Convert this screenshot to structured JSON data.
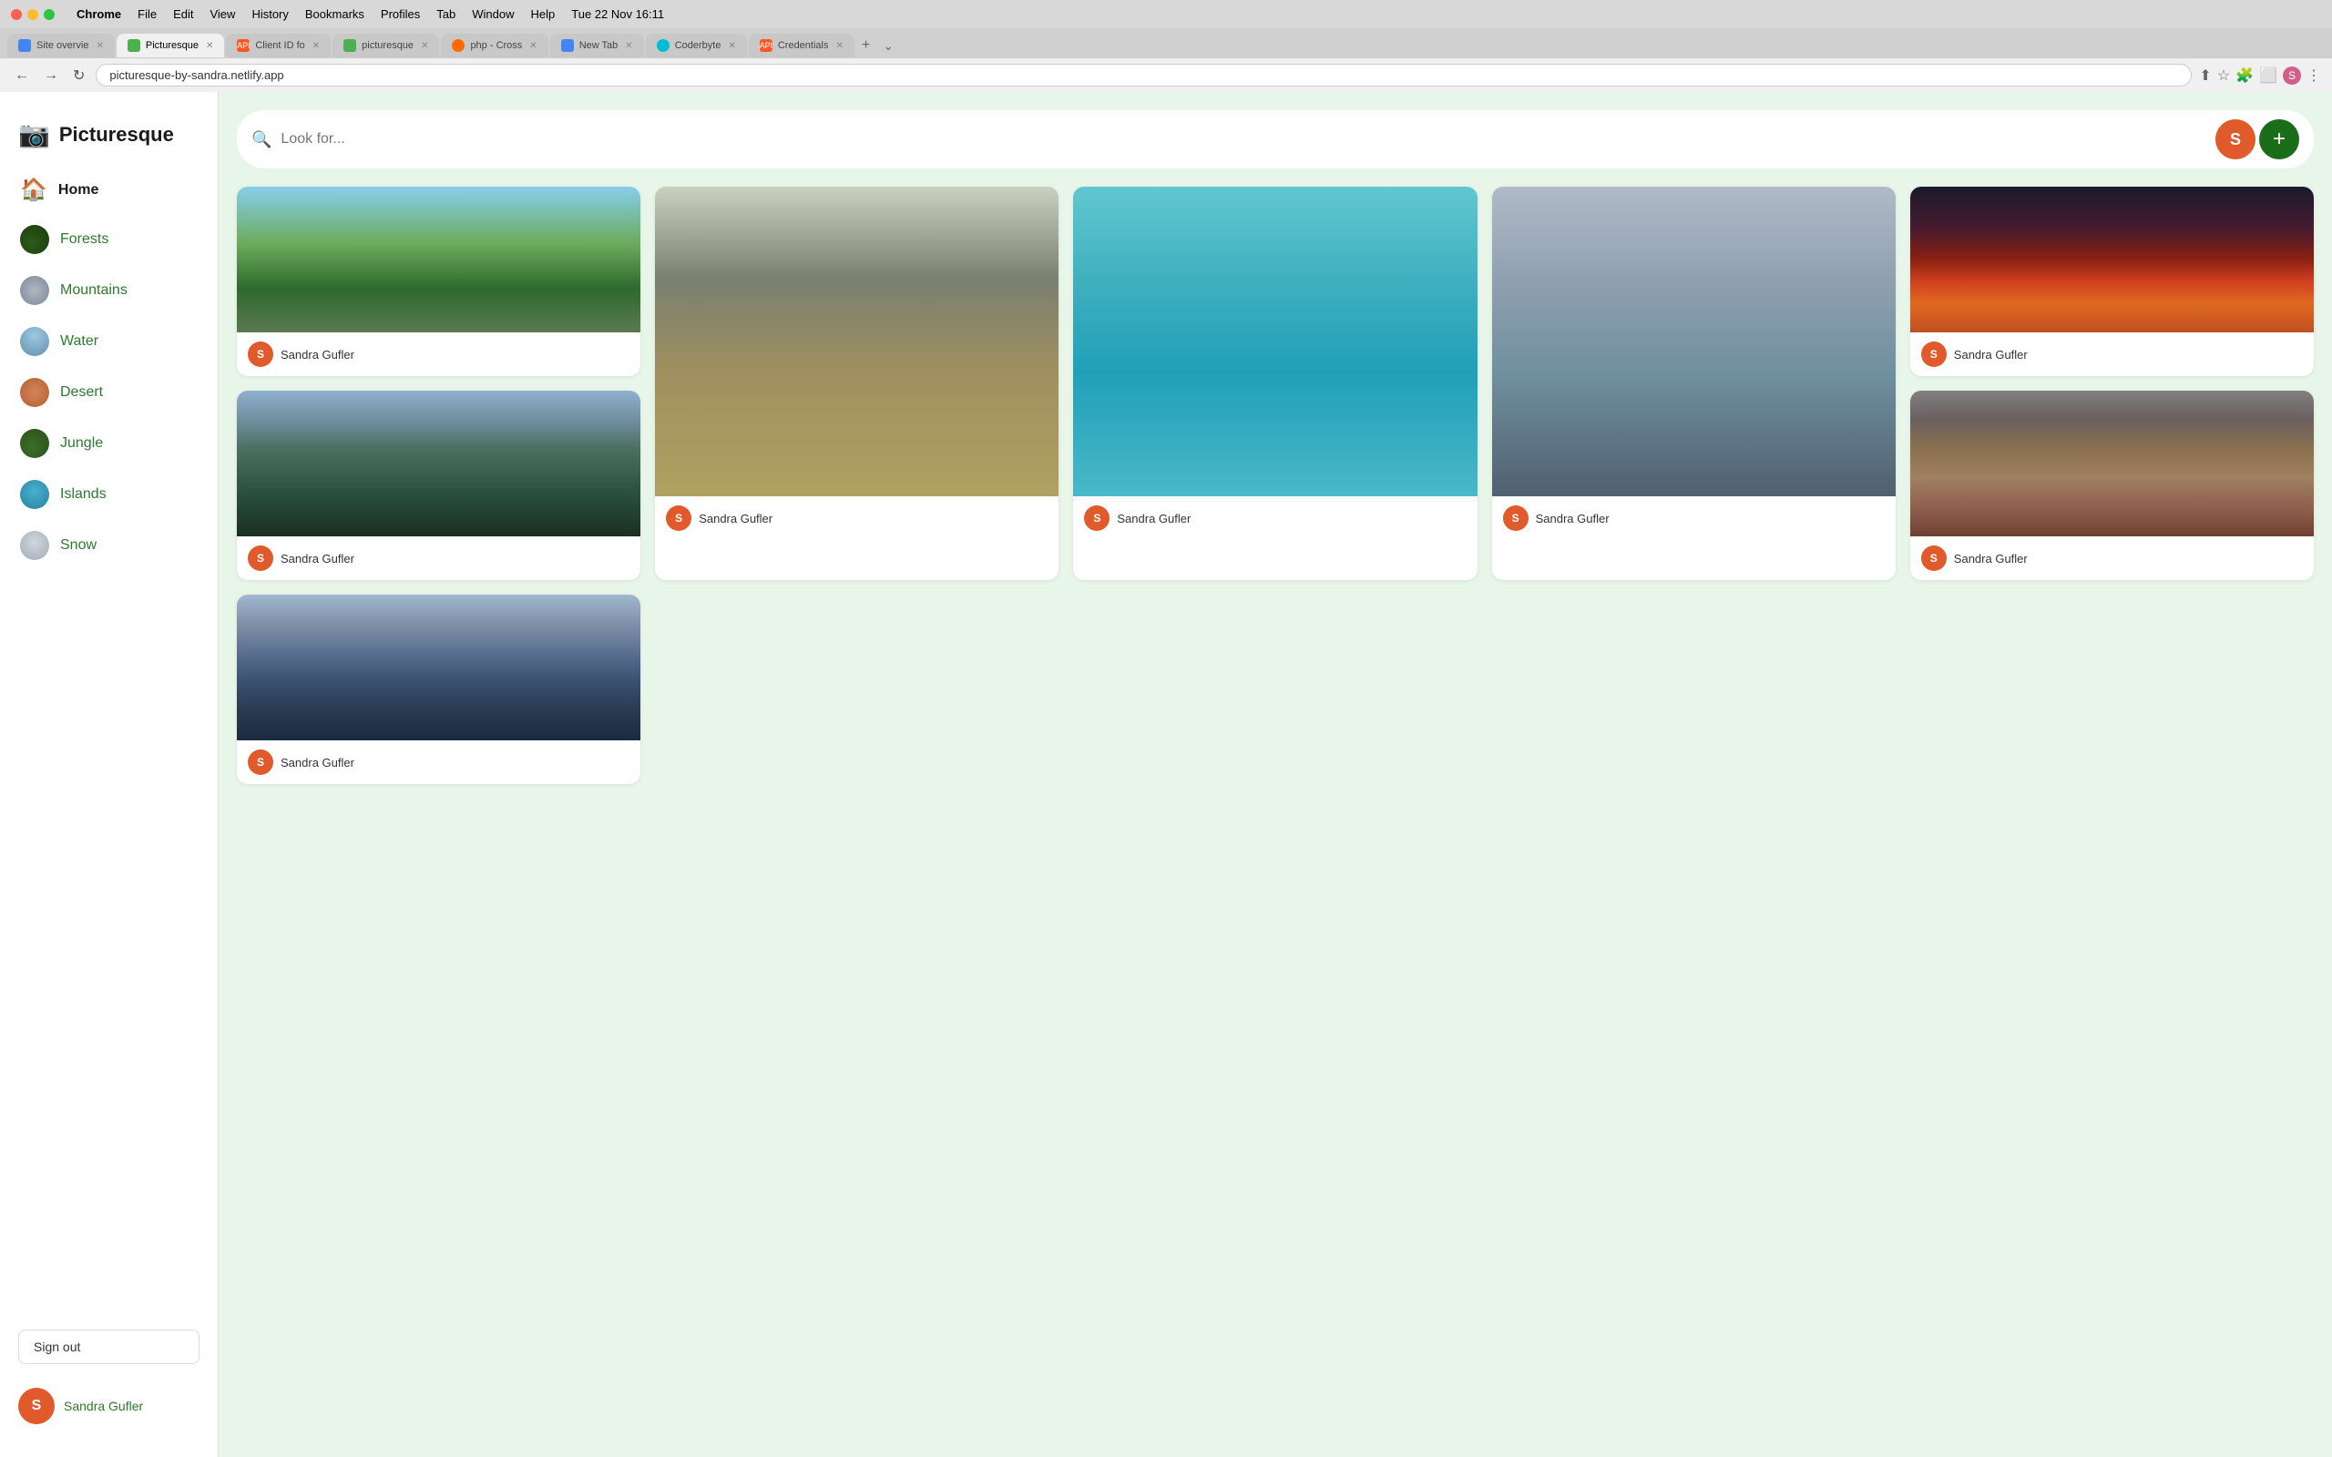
{
  "browser": {
    "app_name": "Chrome",
    "menu_items": [
      "Chrome",
      "File",
      "Edit",
      "View",
      "History",
      "Bookmarks",
      "Profiles",
      "Tab",
      "Window",
      "Help"
    ],
    "datetime": "Tue 22 Nov  16:11",
    "address": "picturesque-by-sandra.netlify.app",
    "tabs": [
      {
        "label": "Site overvie",
        "active": false,
        "favicon_color": "#4285f4"
      },
      {
        "label": "Picturesque",
        "active": true,
        "favicon_color": "#4caf50"
      },
      {
        "label": "Client ID fo",
        "active": false,
        "favicon_color": "#ff5722"
      },
      {
        "label": "picturesque",
        "active": false,
        "favicon_color": "#4caf50"
      },
      {
        "label": "php - Cross",
        "active": false,
        "favicon_color": "#ff6900"
      },
      {
        "label": "New Tab",
        "active": false,
        "favicon_color": "#4285f4"
      },
      {
        "label": "Coderbyte",
        "active": false,
        "favicon_color": "#00bcd4"
      },
      {
        "label": "Credentials",
        "active": false,
        "favicon_color": "#ff5722"
      }
    ]
  },
  "app": {
    "logo_icon": "📷",
    "logo_text": "Picturesque"
  },
  "search": {
    "placeholder": "Look for..."
  },
  "user": {
    "initial": "S",
    "name": "Sandra Gufler"
  },
  "nav": {
    "items": [
      {
        "id": "home",
        "label": "Home",
        "active": true,
        "icon_type": "home"
      },
      {
        "id": "forests",
        "label": "Forests",
        "active": false,
        "icon_type": "forests"
      },
      {
        "id": "mountains",
        "label": "Mountains",
        "active": false,
        "icon_type": "mountains"
      },
      {
        "id": "water",
        "label": "Water",
        "active": false,
        "icon_type": "water"
      },
      {
        "id": "desert",
        "label": "Desert",
        "active": false,
        "icon_type": "desert"
      },
      {
        "id": "jungle",
        "label": "Jungle",
        "active": false,
        "icon_type": "jungle"
      },
      {
        "id": "islands",
        "label": "Islands",
        "active": false,
        "icon_type": "islands"
      },
      {
        "id": "snow",
        "label": "Snow",
        "active": false,
        "icon_type": "snow"
      }
    ]
  },
  "sign_out_label": "Sign out",
  "add_label": "+",
  "photos": [
    {
      "author": "Sandra Gufler",
      "photo_class": "photo-mountains"
    },
    {
      "author": "Sandra Gufler",
      "photo_class": "photo-rocky"
    },
    {
      "author": "Sandra Gufler",
      "photo_class": "photo-water"
    },
    {
      "author": "Sandra Gufler",
      "photo_class": "photo-misty"
    },
    {
      "author": "Sandra Gufler",
      "photo_class": "photo-sunset"
    },
    {
      "author": "Sandra Gufler",
      "photo_class": "photo-peaks"
    },
    {
      "author": "Sandra Gufler",
      "photo_class": "photo-dark-rocks"
    },
    {
      "author": "Sandra Gufler",
      "photo_class": "photo-foggy-forest"
    }
  ]
}
